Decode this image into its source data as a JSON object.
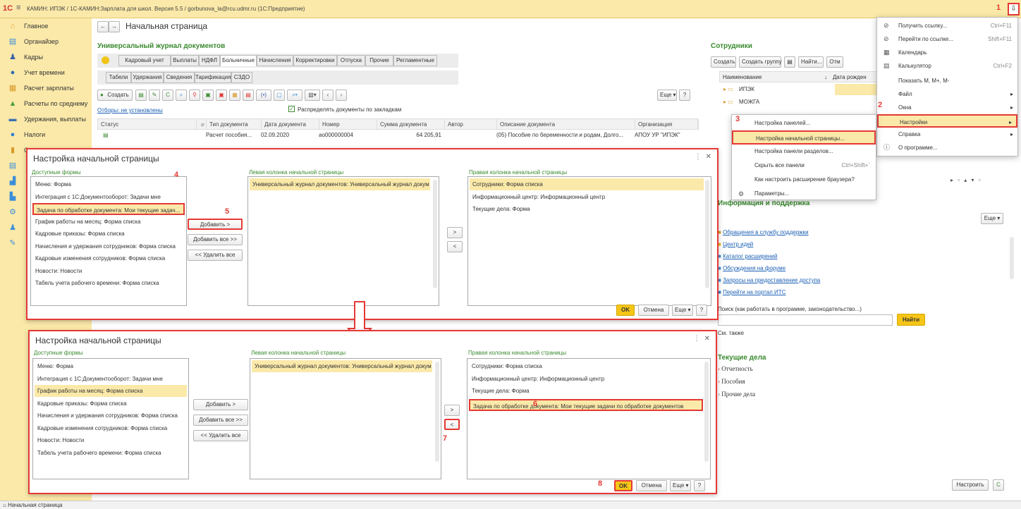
{
  "window": {
    "logo": "1С",
    "title": "КАМИН: ИПЭК / 1С-КАМИН:Зарплата для школ. Версия 5.5 / gorbunova_la@rcu.udmr.ru  (1С:Предприятие)"
  },
  "sidebar": {
    "items": [
      {
        "label": "Главное",
        "icon": "home-icon",
        "color": "#e6a23c",
        "glyph": "⌂"
      },
      {
        "label": "Органайзер",
        "icon": "organizer-icon",
        "color": "#3b8ed8",
        "glyph": "▤"
      },
      {
        "label": "Кадры",
        "icon": "people-icon",
        "color": "#3b5fa8",
        "glyph": "♟"
      },
      {
        "label": "Учет времени",
        "icon": "clock-icon",
        "color": "#2f6db3",
        "glyph": "●"
      },
      {
        "label": "Расчет зарплаты",
        "icon": "calc-icon",
        "color": "#d89a2a",
        "glyph": "▦"
      },
      {
        "label": "Расчеты по среднему",
        "icon": "chart-icon",
        "color": "#4a9e3c",
        "glyph": "▲"
      },
      {
        "label": "Удержания, выплаты",
        "icon": "wallet-icon",
        "color": "#3b6fb3",
        "glyph": "▬"
      },
      {
        "label": "Налоги",
        "icon": "tax-icon",
        "color": "#2f7fd0",
        "glyph": "●"
      },
      {
        "label": "Отчетность",
        "icon": "report-icon",
        "color": "#d89a2a",
        "glyph": "▮"
      }
    ],
    "extra_icons": [
      {
        "icon": "table-icon",
        "color": "#3b8ed8",
        "glyph": "▤"
      },
      {
        "icon": "analytics-icon",
        "color": "#3b8ed8",
        "glyph": "▟"
      },
      {
        "icon": "bar-chart-icon",
        "color": "#3b8ed8",
        "glyph": "▙"
      },
      {
        "icon": "settings-icon",
        "color": "#3b8ed8",
        "glyph": "⚙"
      },
      {
        "icon": "admin-icon",
        "color": "#3b8ed8",
        "glyph": "♟"
      },
      {
        "icon": "tools-icon",
        "color": "#3b8ed8",
        "glyph": "✎"
      }
    ]
  },
  "page": {
    "title": "Начальная страница"
  },
  "journal": {
    "title": "Универсальный журнал документов",
    "tabs1": [
      "Кадровый учет",
      "Выплаты",
      "НДФЛ",
      "Больничные",
      "Начисления",
      "Корректировки",
      "Отпуска",
      "Прочие",
      "Регламентные"
    ],
    "tabs2": [
      "Табели",
      "Удержания",
      "Сведения",
      "Тарификация",
      "СЗДО"
    ],
    "create": "Создать",
    "more": "Еще",
    "help": "?",
    "filter_link": "Отборы: не установлены",
    "distribute": "Распределять документы по закладкам",
    "columns": [
      "Статус",
      "",
      "Тип документа",
      "Дата документа",
      "Номер",
      "Сумма документа",
      "Автор",
      "Описание документа",
      "Организация"
    ],
    "rows": [
      {
        "type": "Расчет пособия...",
        "date": "02.09.2020",
        "number": "ао000000004",
        "sum": "64 205,91",
        "desc": "(05) Пособие по беременности и родам, Долго...",
        "org": "АПОУ УР \"ИПЭК\""
      }
    ]
  },
  "employees": {
    "title": "Сотрудники",
    "create": "Создать",
    "create_group": "Создать группу",
    "find": "Найти...",
    "cancel_find": "Отм",
    "col_name": "Наименование",
    "col_birth": "Дата рожден",
    "groups": [
      "ИПЭК",
      "МОЖГА"
    ]
  },
  "menu": {
    "items": [
      {
        "label": "Получить ссылку...",
        "shortcut": "Ctrl+F11",
        "icon": "link-icon",
        "glyph": "⊘"
      },
      {
        "label": "Перейти по ссылке...",
        "shortcut": "Shift+F11",
        "icon": "goto-link-icon",
        "glyph": "⊘"
      },
      {
        "label": "Календарь",
        "shortcut": "",
        "icon": "calendar-icon",
        "glyph": "▦"
      },
      {
        "label": "Калькулятор",
        "shortcut": "Ctrl+F2",
        "icon": "calculator-icon",
        "glyph": "▤"
      },
      {
        "label": "Показать М, М+, М-",
        "shortcut": "",
        "icon": "",
        "glyph": ""
      },
      {
        "label": "Файл",
        "shortcut": "",
        "icon": "",
        "glyph": "",
        "arrow": "▸"
      },
      {
        "label": "Окна",
        "shortcut": "",
        "icon": "",
        "glyph": "",
        "arrow": "▸"
      },
      {
        "label": "Настройки",
        "shortcut": "",
        "icon": "",
        "glyph": "",
        "arrow": "▸"
      },
      {
        "label": "Справка",
        "shortcut": "",
        "icon": "",
        "glyph": "",
        "arrow": "▸"
      },
      {
        "label": "О программе...",
        "shortcut": "",
        "icon": "info-icon",
        "glyph": "ⓘ"
      }
    ]
  },
  "submenu": {
    "items": [
      {
        "label": "Настройка панелей...",
        "shortcut": ""
      },
      {
        "label": "Настройка начальной страницы...",
        "shortcut": ""
      },
      {
        "label": "Настройка панели разделов...",
        "shortcut": ""
      },
      {
        "label": "Скрыть все панели",
        "shortcut": "Ctrl+Shift+`"
      },
      {
        "label": "Как настроить расширение браузера?",
        "shortcut": ""
      },
      {
        "label": "Параметры...",
        "shortcut": ""
      }
    ]
  },
  "info": {
    "title": "Информация и поддержка",
    "more": "Еще",
    "links": [
      {
        "label": "Обращения в службу поддержки",
        "icon": "mail-icon",
        "color": "#d89a2a"
      },
      {
        "label": "Центр идей",
        "icon": "idea-icon",
        "color": "#e6b422"
      },
      {
        "label": "Каталог расширений",
        "icon": "catalog-icon",
        "color": "#3b8ed8"
      },
      {
        "label": "Обсуждения на форуме",
        "icon": "forum-icon",
        "color": "#3b8ed8"
      },
      {
        "label": "Запросы на предоставление доступа",
        "icon": "access-icon",
        "color": "#3b8ed8"
      },
      {
        "label": "Перейти на портал ИТС",
        "icon": "its-icon",
        "color": "#2f7fd0"
      }
    ],
    "search_label": "Поиск (как работать в программе, законодательство...)",
    "find_btn": "Найти",
    "see_also": "См. также"
  },
  "current": {
    "title": "Текущие дела",
    "items": [
      "Отчетность",
      "Пособия",
      "Прочие дела"
    ]
  },
  "bottom_buttons": {
    "configure": "Настроить",
    "refresh": "C"
  },
  "dialog": {
    "title": "Настройка начальной страницы",
    "available_label": "Доступные формы",
    "left_label": "Левая колонка начальной страницы",
    "right_label": "Правая колонка начальной страницы",
    "remove": "< Удалить",
    "add": "Добавить >",
    "add_all": "Добавить все >>",
    "remove_all": "<< Удалить все",
    "move_right": ">",
    "move_left": "<",
    "ok": "OK",
    "cancel": "Отмена",
    "more": "Еще",
    "help": "?",
    "menu_glyph": "⋮",
    "close_glyph": "✕"
  },
  "dialog1": {
    "available": [
      "Меню: Форма",
      "Интеграция с 1С:Документооборот: Задачи мне",
      "Задача по обработке документа: Мои текущие задач...",
      "График работы на месяц: Форма списка",
      "Кадровые приказы: Форма списка",
      "Начисления и удержания сотрудников: Форма списка",
      "Кадровые изменения сотрудников: Форма списка",
      "Новости: Новости",
      "Табель учета рабочего времени: Форма списка"
    ],
    "left": [
      "Универсальный журнал документов: Универсальный журнал докум"
    ],
    "right": [
      "Сотрудники: Форма списка",
      "Информационный центр: Информационный центр",
      "Текущие дела: Форма"
    ]
  },
  "dialog2": {
    "available": [
      "Меню: Форма",
      "Интеграция с 1С:Документооборот: Задачи мне",
      "График работы на месяц: Форма списка",
      "Кадровые приказы: Форма списка",
      "Начисления и удержания сотрудников: Форма списка",
      "Кадровые изменения сотрудников: Форма списка",
      "Новости: Новости",
      "Табель учета рабочего времени: Форма списка"
    ],
    "left": [
      "Универсальный журнал документов: Универсальный журнал докум"
    ],
    "right": [
      "Сотрудники: Форма списка",
      "Информационный центр: Информационный центр",
      "Текущие дела: Форма",
      "Задача по обработке документа: Мои текущие задачи по обработке документов"
    ]
  },
  "steps": [
    "1",
    "2",
    "3",
    "4",
    "5",
    "6",
    "7",
    "8"
  ],
  "colors": {
    "accent_red": "#e53935",
    "highlight": "#fbe9a9",
    "green": "#3a8a2f",
    "ok_yellow": "#f5c518"
  },
  "statusbar": {
    "tab": "Начальная страница"
  }
}
